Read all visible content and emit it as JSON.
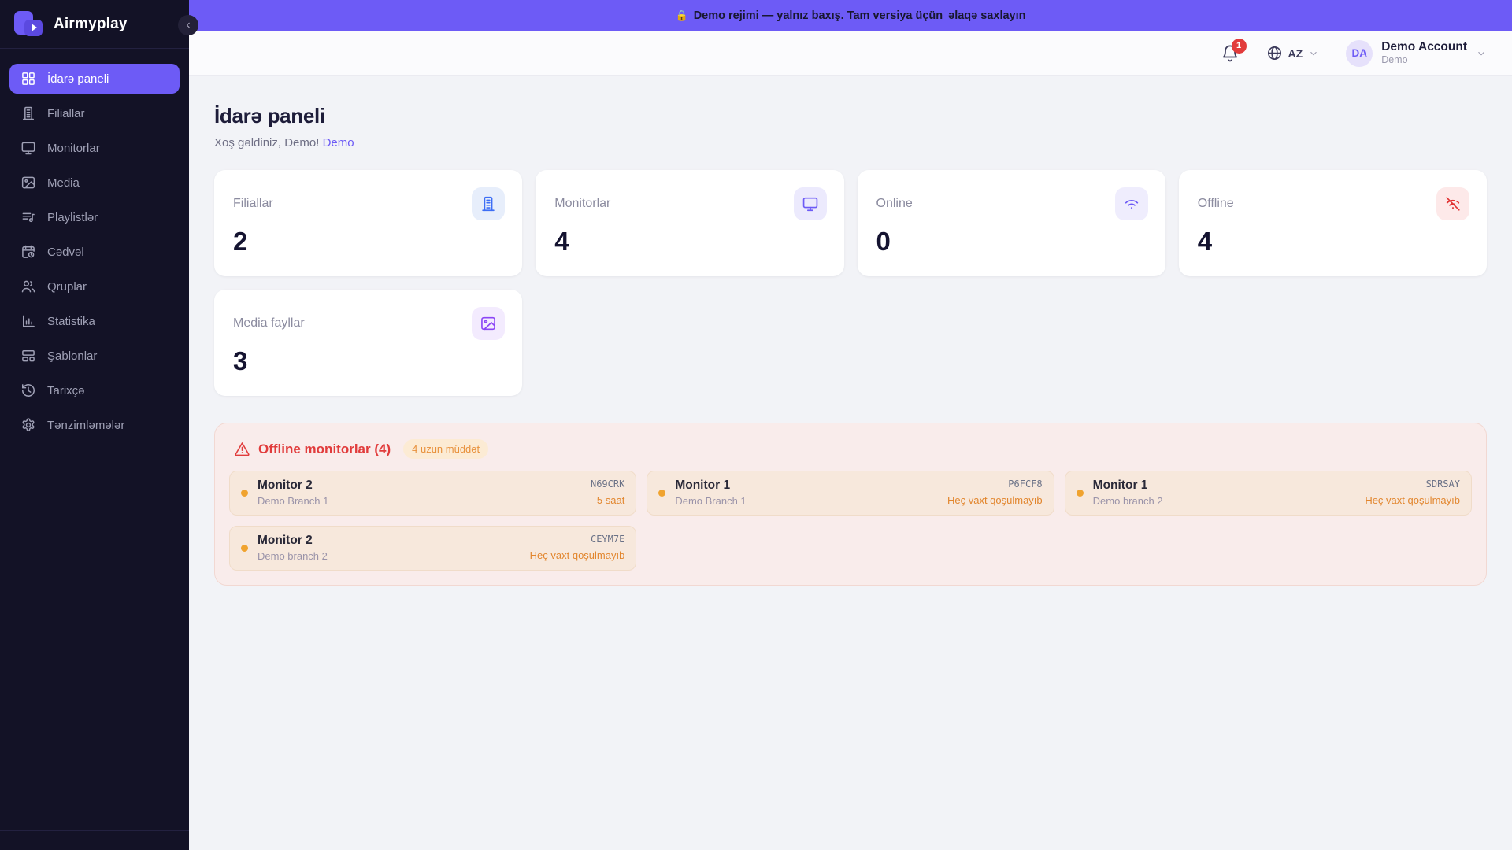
{
  "brand": {
    "name": "Airmyplay"
  },
  "banner": {
    "lock_icon": "🔒",
    "text": "Demo rejimi — yalnız baxış. Tam versiya üçün",
    "link": "əlaqə saxlayın"
  },
  "header": {
    "notification_count": "1",
    "language": "AZ",
    "account": {
      "initials": "DA",
      "name": "Demo Account",
      "role": "Demo"
    }
  },
  "sidebar": {
    "items": [
      {
        "label": "İdarə paneli",
        "icon": "ic-dashboard",
        "active": true
      },
      {
        "label": "Filiallar",
        "icon": "ic-building",
        "active": false
      },
      {
        "label": "Monitorlar",
        "icon": "ic-monitor",
        "active": false
      },
      {
        "label": "Media",
        "icon": "ic-image",
        "active": false
      },
      {
        "label": "Playlistlər",
        "icon": "ic-playlist",
        "active": false
      },
      {
        "label": "Cədvəl",
        "icon": "ic-calendar",
        "active": false
      },
      {
        "label": "Qruplar",
        "icon": "ic-users",
        "active": false
      },
      {
        "label": "Statistika",
        "icon": "ic-chart",
        "active": false
      },
      {
        "label": "Şablonlar",
        "icon": "ic-layout",
        "active": false
      },
      {
        "label": "Tarixçə",
        "icon": "ic-history",
        "active": false
      },
      {
        "label": "Tənzimləmələr",
        "icon": "ic-gear",
        "active": false
      }
    ]
  },
  "page": {
    "title": "İdarə paneli",
    "welcome_prefix": "Xoş gəldiniz, Demo!",
    "welcome_link": "Demo"
  },
  "stats": [
    {
      "label": "Filiallar",
      "value": "2",
      "icon": "ic-building",
      "icon_color": "#3d6ef5",
      "icon_bg": "#e7eefb"
    },
    {
      "label": "Monitorlar",
      "value": "4",
      "icon": "ic-monitor",
      "icon_color": "#6d5bf6",
      "icon_bg": "#eceafd"
    },
    {
      "label": "Online",
      "value": "0",
      "icon": "ic-wifi",
      "icon_color": "#6d5bf6",
      "icon_bg": "#efedfd"
    },
    {
      "label": "Offline",
      "value": "4",
      "icon": "ic-wifi-off",
      "icon_color": "#e13131",
      "icon_bg": "#fde9e9"
    },
    {
      "label": "Media fayllar",
      "value": "3",
      "icon": "ic-image",
      "icon_color": "#8b45f6",
      "icon_bg": "#f3ebfe"
    }
  ],
  "offline_section": {
    "title": "Offline monitorlar (4)",
    "badge": "4 uzun müddət",
    "monitors": [
      {
        "name": "Monitor 2",
        "branch": "Demo Branch 1",
        "code": "N69CRK",
        "status": "5 saat"
      },
      {
        "name": "Monitor 1",
        "branch": "Demo Branch 1",
        "code": "P6FCF8",
        "status": "Heç vaxt qoşulmayıb"
      },
      {
        "name": "Monitor 1",
        "branch": "Demo branch 2",
        "code": "SDRSAY",
        "status": "Heç vaxt qoşulmayıb"
      },
      {
        "name": "Monitor 2",
        "branch": "Demo branch 2",
        "code": "CEYM7E",
        "status": "Heç vaxt qoşulmayıb"
      }
    ]
  },
  "colors": {
    "accent": "#6d5bf6",
    "danger": "#e13c3c",
    "warning": "#e8913c",
    "sidebar_bg": "#131226"
  }
}
